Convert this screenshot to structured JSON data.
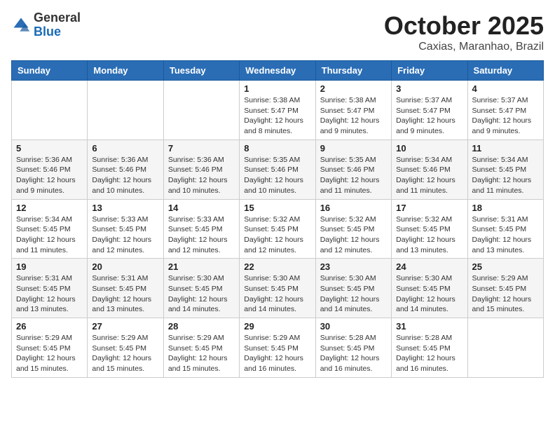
{
  "header": {
    "logo_general": "General",
    "logo_blue": "Blue",
    "month_title": "October 2025",
    "location": "Caxias, Maranhao, Brazil"
  },
  "days_of_week": [
    "Sunday",
    "Monday",
    "Tuesday",
    "Wednesday",
    "Thursday",
    "Friday",
    "Saturday"
  ],
  "weeks": [
    [
      {
        "day": "",
        "info": ""
      },
      {
        "day": "",
        "info": ""
      },
      {
        "day": "",
        "info": ""
      },
      {
        "day": "1",
        "info": "Sunrise: 5:38 AM\nSunset: 5:47 PM\nDaylight: 12 hours\nand 8 minutes."
      },
      {
        "day": "2",
        "info": "Sunrise: 5:38 AM\nSunset: 5:47 PM\nDaylight: 12 hours\nand 9 minutes."
      },
      {
        "day": "3",
        "info": "Sunrise: 5:37 AM\nSunset: 5:47 PM\nDaylight: 12 hours\nand 9 minutes."
      },
      {
        "day": "4",
        "info": "Sunrise: 5:37 AM\nSunset: 5:47 PM\nDaylight: 12 hours\nand 9 minutes."
      }
    ],
    [
      {
        "day": "5",
        "info": "Sunrise: 5:36 AM\nSunset: 5:46 PM\nDaylight: 12 hours\nand 9 minutes."
      },
      {
        "day": "6",
        "info": "Sunrise: 5:36 AM\nSunset: 5:46 PM\nDaylight: 12 hours\nand 10 minutes."
      },
      {
        "day": "7",
        "info": "Sunrise: 5:36 AM\nSunset: 5:46 PM\nDaylight: 12 hours\nand 10 minutes."
      },
      {
        "day": "8",
        "info": "Sunrise: 5:35 AM\nSunset: 5:46 PM\nDaylight: 12 hours\nand 10 minutes."
      },
      {
        "day": "9",
        "info": "Sunrise: 5:35 AM\nSunset: 5:46 PM\nDaylight: 12 hours\nand 11 minutes."
      },
      {
        "day": "10",
        "info": "Sunrise: 5:34 AM\nSunset: 5:46 PM\nDaylight: 12 hours\nand 11 minutes."
      },
      {
        "day": "11",
        "info": "Sunrise: 5:34 AM\nSunset: 5:45 PM\nDaylight: 12 hours\nand 11 minutes."
      }
    ],
    [
      {
        "day": "12",
        "info": "Sunrise: 5:34 AM\nSunset: 5:45 PM\nDaylight: 12 hours\nand 11 minutes."
      },
      {
        "day": "13",
        "info": "Sunrise: 5:33 AM\nSunset: 5:45 PM\nDaylight: 12 hours\nand 12 minutes."
      },
      {
        "day": "14",
        "info": "Sunrise: 5:33 AM\nSunset: 5:45 PM\nDaylight: 12 hours\nand 12 minutes."
      },
      {
        "day": "15",
        "info": "Sunrise: 5:32 AM\nSunset: 5:45 PM\nDaylight: 12 hours\nand 12 minutes."
      },
      {
        "day": "16",
        "info": "Sunrise: 5:32 AM\nSunset: 5:45 PM\nDaylight: 12 hours\nand 12 minutes."
      },
      {
        "day": "17",
        "info": "Sunrise: 5:32 AM\nSunset: 5:45 PM\nDaylight: 12 hours\nand 13 minutes."
      },
      {
        "day": "18",
        "info": "Sunrise: 5:31 AM\nSunset: 5:45 PM\nDaylight: 12 hours\nand 13 minutes."
      }
    ],
    [
      {
        "day": "19",
        "info": "Sunrise: 5:31 AM\nSunset: 5:45 PM\nDaylight: 12 hours\nand 13 minutes."
      },
      {
        "day": "20",
        "info": "Sunrise: 5:31 AM\nSunset: 5:45 PM\nDaylight: 12 hours\nand 13 minutes."
      },
      {
        "day": "21",
        "info": "Sunrise: 5:30 AM\nSunset: 5:45 PM\nDaylight: 12 hours\nand 14 minutes."
      },
      {
        "day": "22",
        "info": "Sunrise: 5:30 AM\nSunset: 5:45 PM\nDaylight: 12 hours\nand 14 minutes."
      },
      {
        "day": "23",
        "info": "Sunrise: 5:30 AM\nSunset: 5:45 PM\nDaylight: 12 hours\nand 14 minutes."
      },
      {
        "day": "24",
        "info": "Sunrise: 5:30 AM\nSunset: 5:45 PM\nDaylight: 12 hours\nand 14 minutes."
      },
      {
        "day": "25",
        "info": "Sunrise: 5:29 AM\nSunset: 5:45 PM\nDaylight: 12 hours\nand 15 minutes."
      }
    ],
    [
      {
        "day": "26",
        "info": "Sunrise: 5:29 AM\nSunset: 5:45 PM\nDaylight: 12 hours\nand 15 minutes."
      },
      {
        "day": "27",
        "info": "Sunrise: 5:29 AM\nSunset: 5:45 PM\nDaylight: 12 hours\nand 15 minutes."
      },
      {
        "day": "28",
        "info": "Sunrise: 5:29 AM\nSunset: 5:45 PM\nDaylight: 12 hours\nand 15 minutes."
      },
      {
        "day": "29",
        "info": "Sunrise: 5:29 AM\nSunset: 5:45 PM\nDaylight: 12 hours\nand 16 minutes."
      },
      {
        "day": "30",
        "info": "Sunrise: 5:28 AM\nSunset: 5:45 PM\nDaylight: 12 hours\nand 16 minutes."
      },
      {
        "day": "31",
        "info": "Sunrise: 5:28 AM\nSunset: 5:45 PM\nDaylight: 12 hours\nand 16 minutes."
      },
      {
        "day": "",
        "info": ""
      }
    ]
  ]
}
